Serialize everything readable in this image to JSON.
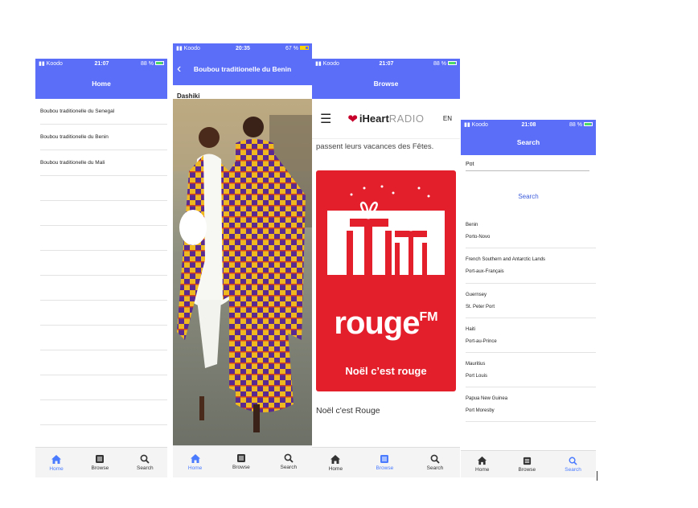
{
  "colors": {
    "nav": "#5a6ef7",
    "accent": "#4a7bff",
    "rouge": "#e41f2c"
  },
  "status": {
    "p1": {
      "carrier": "Koodo",
      "time": "21:07",
      "battery": "88 %"
    },
    "p2": {
      "carrier": "Koodo",
      "time": "20:35",
      "battery": "67 %"
    },
    "p3": {
      "carrier": "Koodo",
      "time": "21:07",
      "battery": "88 %"
    },
    "p4": {
      "carrier": "Koodo",
      "time": "21:08",
      "battery": "88 %"
    }
  },
  "screen_home": {
    "title": "Home",
    "items": [
      "Boubou traditionelle du Senegal",
      "Boubou traditionelle du Benin",
      "Boubou traditionelle du Mali"
    ]
  },
  "screen_detail": {
    "title": "Boubou traditionelle du Benin",
    "caption": "Dashiki"
  },
  "screen_browse": {
    "title": "Browse",
    "brand": "iHeart",
    "brand2": "RADIO",
    "lang": "EN",
    "snippet": "passent leurs vacances des Fêtes.",
    "card_brand": "rouge",
    "card_fm": "FM",
    "card_tagline": "Noël c’est rouge",
    "card_title": "Noël c'est Rouge"
  },
  "screen_search": {
    "title": "Search",
    "query": "Pot",
    "button": "Search",
    "results": [
      {
        "country": "Benin",
        "capital": "Porto-Novo"
      },
      {
        "country": "French Southern and Antarctic Lands",
        "capital": "Port-aux-Français"
      },
      {
        "country": "Guernsey",
        "capital": "St. Peter Port"
      },
      {
        "country": "Haiti",
        "capital": "Port-au-Prince"
      },
      {
        "country": "Mauritius",
        "capital": "Port Louis"
      },
      {
        "country": "Papua New Guinea",
        "capital": "Port Moresby"
      }
    ]
  },
  "tabs": [
    "Home",
    "Browse",
    "Search"
  ]
}
